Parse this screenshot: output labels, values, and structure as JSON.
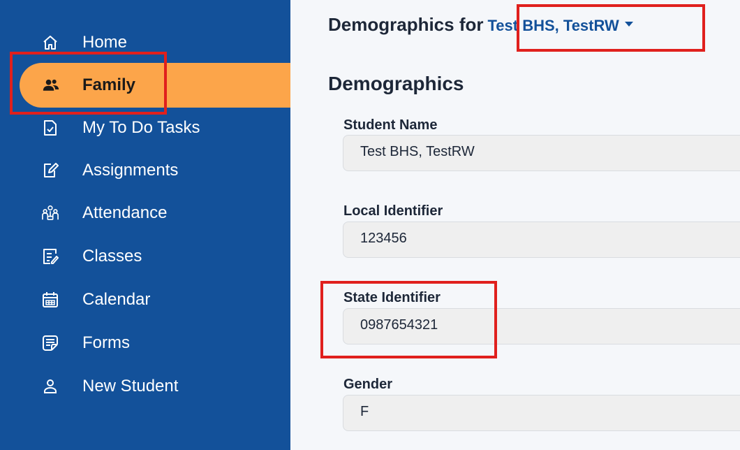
{
  "sidebar": {
    "items": [
      {
        "label": "Home",
        "icon": "home-icon"
      },
      {
        "label": "Family",
        "icon": "family-icon",
        "active": true
      },
      {
        "label": "My To Do Tasks",
        "icon": "todo-icon"
      },
      {
        "label": "Assignments",
        "icon": "assignments-icon"
      },
      {
        "label": "Attendance",
        "icon": "attendance-icon"
      },
      {
        "label": "Classes",
        "icon": "classes-icon"
      },
      {
        "label": "Calendar",
        "icon": "calendar-icon"
      },
      {
        "label": "Forms",
        "icon": "forms-icon"
      },
      {
        "label": "New Student",
        "icon": "new-student-icon"
      }
    ]
  },
  "main": {
    "heading_prefix": "Demographics for",
    "student_selector": "Test BHS, TestRW",
    "section_title": "Demographics",
    "fields": [
      {
        "label": "Student Name",
        "value": "Test BHS, TestRW"
      },
      {
        "label": "Local Identifier",
        "value": "123456"
      },
      {
        "label": "State Identifier",
        "value": "0987654321"
      },
      {
        "label": "Gender",
        "value": "F"
      }
    ]
  },
  "colors": {
    "sidebar_bg": "#13519a",
    "active_item_bg": "#fca54a",
    "highlight_border": "#e0201d",
    "link_blue": "#13519a"
  }
}
